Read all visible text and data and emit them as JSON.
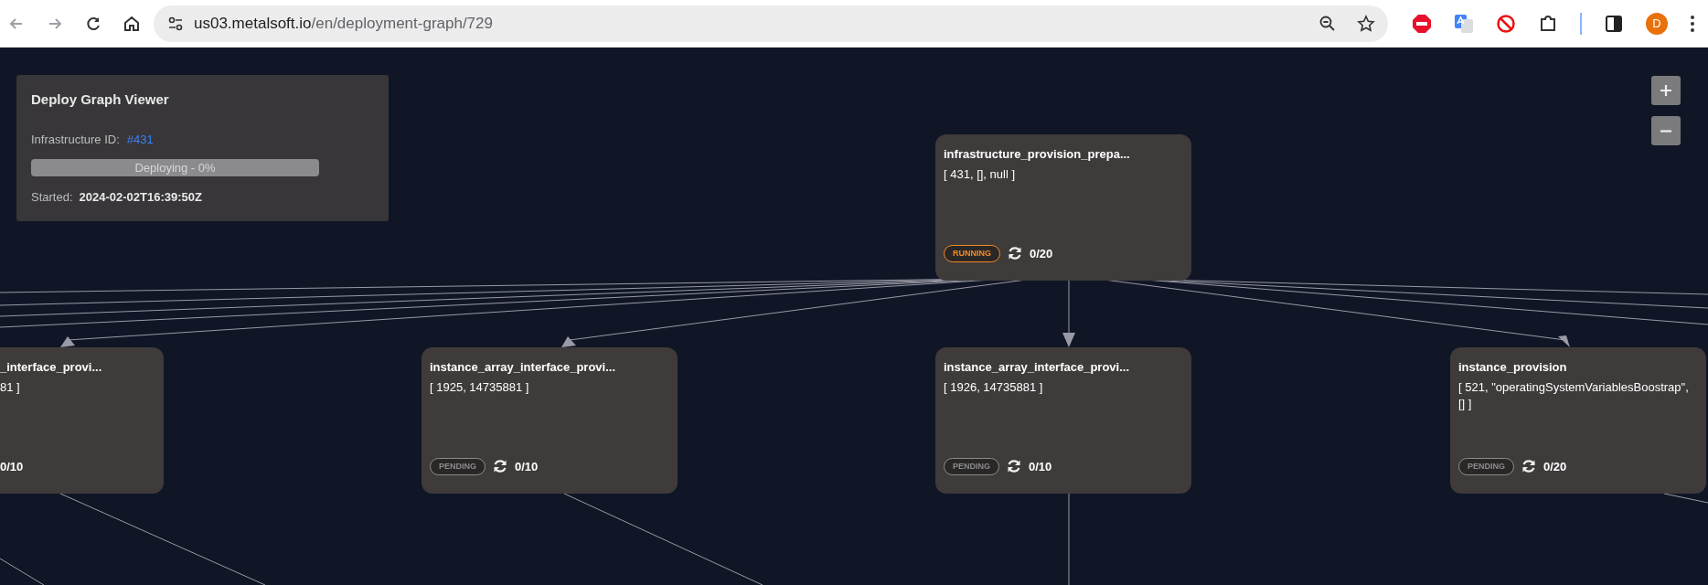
{
  "browser": {
    "url_host": "us03.metalsoft.io",
    "url_path": "/en/deployment-graph/729",
    "profile_initial": "D"
  },
  "info_panel": {
    "title": "Deploy Graph Viewer",
    "id_label": "Infrastructure ID:",
    "id_value": "#431",
    "progress": {
      "label": "Deploying - 0%",
      "level": 0
    },
    "started_label": "Started:",
    "started_value": "2024-02-02T16:39:50Z"
  },
  "graph": {
    "nodes": [
      {
        "kind": "full",
        "title": "infrastructure_provision_prepa...",
        "args": "[ 431, [], null ]",
        "status": "RUNNING",
        "color": "#f08a24",
        "count": "0/20"
      },
      {
        "kind": "clipped",
        "title": "_interface_provi...",
        "args": "81 ]",
        "count": "0/10"
      },
      {
        "kind": "full",
        "title": "instance_array_interface_provi...",
        "args": "[ 1925, 14735881 ]",
        "status": "PENDING",
        "color": "#8c8c8c",
        "count": "0/10"
      },
      {
        "kind": "full",
        "title": "instance_array_interface_provi...",
        "args": "[ 1926, 14735881 ]",
        "status": "PENDING",
        "color": "#8c8c8c",
        "count": "0/10"
      },
      {
        "kind": "full",
        "title": "instance_provision",
        "args": "[ 521, \"operatingSystemVariablesBoostrap\", [] ]",
        "status": "PENDING",
        "color": "#8c8c8c",
        "count": "0/20"
      }
    ]
  }
}
